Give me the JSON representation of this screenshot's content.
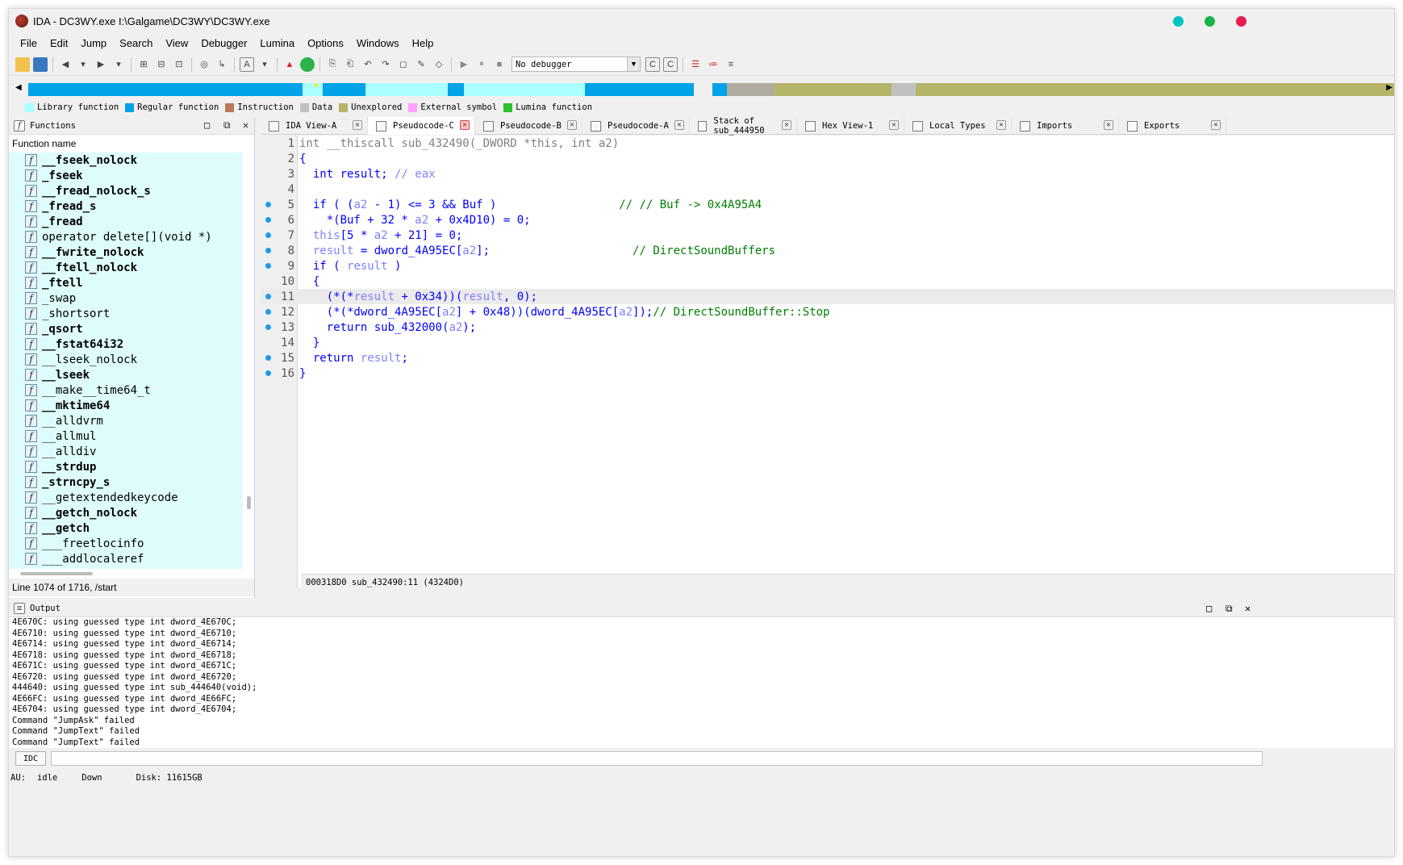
{
  "window": {
    "title": "IDA - DC3WY.exe I:\\Galgame\\DC3WY\\DC3WY.exe",
    "controls": {
      "minimize_color": "#00c3c3",
      "maximize_color": "#1ab34a",
      "close_color": "#e81c4f"
    }
  },
  "menu": [
    "File",
    "Edit",
    "Jump",
    "Search",
    "View",
    "Debugger",
    "Lumina",
    "Options",
    "Windows",
    "Help"
  ],
  "toolbar": {
    "debugger_select": "No debugger"
  },
  "legend": [
    {
      "label": "Library function",
      "color": "#aaffff"
    },
    {
      "label": "Regular function",
      "color": "#00a2e8"
    },
    {
      "label": "Instruction",
      "color": "#b9795b"
    },
    {
      "label": "Data",
      "color": "#c0c0c0"
    },
    {
      "label": "Unexplored",
      "color": "#b5b56a"
    },
    {
      "label": "External symbol",
      "color": "#ffa0ff"
    },
    {
      "label": "Lumina function",
      "color": "#2ec02e"
    }
  ],
  "functions": {
    "title": "Functions",
    "column": "Function name",
    "items": [
      {
        "name": "__fseek_nolock",
        "bold": true
      },
      {
        "name": "_fseek",
        "bold": true
      },
      {
        "name": "__fread_nolock_s",
        "bold": true
      },
      {
        "name": "_fread_s",
        "bold": true
      },
      {
        "name": "_fread",
        "bold": true
      },
      {
        "name": "operator delete[](void *)",
        "bold": false
      },
      {
        "name": "__fwrite_nolock",
        "bold": true
      },
      {
        "name": "__ftell_nolock",
        "bold": true
      },
      {
        "name": "_ftell",
        "bold": true
      },
      {
        "name": "_swap",
        "bold": false
      },
      {
        "name": "_shortsort",
        "bold": false
      },
      {
        "name": "_qsort",
        "bold": true
      },
      {
        "name": "__fstat64i32",
        "bold": true
      },
      {
        "name": "__lseek_nolock",
        "bold": false
      },
      {
        "name": "__lseek",
        "bold": true
      },
      {
        "name": "__make__time64_t",
        "bold": false
      },
      {
        "name": "__mktime64",
        "bold": true
      },
      {
        "name": "__alldvrm",
        "bold": false
      },
      {
        "name": "__allmul",
        "bold": false
      },
      {
        "name": "__alldiv",
        "bold": false
      },
      {
        "name": "__strdup",
        "bold": true
      },
      {
        "name": "_strncpy_s",
        "bold": true
      },
      {
        "name": "__getextendedkeycode",
        "bold": false
      },
      {
        "name": "__getch_nolock",
        "bold": true
      },
      {
        "name": "__getch",
        "bold": true
      },
      {
        "name": "___freetlocinfo",
        "bold": false
      },
      {
        "name": "___addlocaleref",
        "bold": false
      }
    ],
    "status": "Line 1074 of 1716, /start"
  },
  "tabs": [
    {
      "label": "IDA View-A",
      "active": false
    },
    {
      "label": "Pseudocode-C",
      "active": true
    },
    {
      "label": "Pseudocode-B",
      "active": false
    },
    {
      "label": "Pseudocode-A",
      "active": false
    },
    {
      "label": "Stack of sub_444950",
      "active": false
    },
    {
      "label": "Hex View-1",
      "active": false
    },
    {
      "label": "Local Types",
      "active": false
    },
    {
      "label": "Imports",
      "active": false
    },
    {
      "label": "Exports",
      "active": false
    }
  ],
  "code": {
    "lines": [
      {
        "n": "1",
        "dot": false,
        "segs": [
          [
            "gr",
            "int __thiscall sub_432490(_DWORD *this, int a2)"
          ]
        ]
      },
      {
        "n": "2",
        "dot": false,
        "segs": [
          [
            "kw",
            "{"
          ]
        ]
      },
      {
        "n": "3",
        "dot": false,
        "segs": [
          [
            "kw",
            "  int result; "
          ],
          [
            "var",
            "// eax"
          ]
        ]
      },
      {
        "n": "4",
        "dot": false,
        "segs": []
      },
      {
        "n": "5",
        "dot": true,
        "segs": [
          [
            "kw",
            "  if ( ("
          ],
          [
            "var",
            "a2"
          ],
          [
            "kw",
            " - 1) <= 3 && Buf )                  "
          ],
          [
            "cm",
            "// // Buf -> 0x4A95A4"
          ]
        ]
      },
      {
        "n": "6",
        "dot": true,
        "segs": [
          [
            "kw",
            "    *(Buf + 32 * "
          ],
          [
            "var",
            "a2"
          ],
          [
            "kw",
            " + 0x4D10) = 0;"
          ]
        ]
      },
      {
        "n": "7",
        "dot": true,
        "segs": [
          [
            "var",
            "  this"
          ],
          [
            "kw",
            "[5 * "
          ],
          [
            "var",
            "a2"
          ],
          [
            "kw",
            " + 21] = 0;"
          ]
        ]
      },
      {
        "n": "8",
        "dot": true,
        "segs": [
          [
            "var",
            "  result"
          ],
          [
            "kw",
            " = dword_4A95EC["
          ],
          [
            "var",
            "a2"
          ],
          [
            "kw",
            "];                     "
          ],
          [
            "cm",
            "// DirectSoundBuffers"
          ]
        ]
      },
      {
        "n": "9",
        "dot": true,
        "segs": [
          [
            "kw",
            "  if ( "
          ],
          [
            "var",
            "result"
          ],
          [
            "kw",
            " )"
          ]
        ]
      },
      {
        "n": "10",
        "dot": false,
        "segs": [
          [
            "kw",
            "  {"
          ]
        ]
      },
      {
        "n": "11",
        "dot": true,
        "segs": [
          [
            "kw",
            "    (*(*"
          ],
          [
            "var",
            "result"
          ],
          [
            "kw",
            " + 0x34))("
          ],
          [
            "var",
            "result"
          ],
          [
            "kw",
            ", 0);"
          ]
        ]
      },
      {
        "n": "12",
        "dot": true,
        "segs": [
          [
            "kw",
            "    (*(*dword_4A95EC["
          ],
          [
            "var",
            "a2"
          ],
          [
            "kw",
            "] + 0x48))(dword_4A95EC["
          ],
          [
            "var",
            "a2"
          ],
          [
            "kw",
            "]);"
          ],
          [
            "cm",
            "// DirectSoundBuffer::Stop"
          ]
        ]
      },
      {
        "n": "13",
        "dot": true,
        "segs": [
          [
            "kw",
            "    return sub_432000("
          ],
          [
            "var",
            "a2"
          ],
          [
            "kw",
            ");"
          ]
        ]
      },
      {
        "n": "14",
        "dot": false,
        "segs": [
          [
            "kw",
            "  }"
          ]
        ]
      },
      {
        "n": "15",
        "dot": true,
        "segs": [
          [
            "kw",
            "  return "
          ],
          [
            "var",
            "result"
          ],
          [
            "kw",
            ";"
          ]
        ]
      },
      {
        "n": "16",
        "dot": true,
        "segs": [
          [
            "kw",
            "}"
          ]
        ]
      }
    ],
    "highlight_line": "11",
    "status": "000318D0 sub_432490:11 (4324D0)"
  },
  "output": {
    "title": "Output",
    "lines": [
      "4E670C: using guessed type int dword_4E670C;",
      "4E6710: using guessed type int dword_4E6710;",
      "4E6714: using guessed type int dword_4E6714;",
      "4E6718: using guessed type int dword_4E6718;",
      "4E671C: using guessed type int dword_4E671C;",
      "4E6720: using guessed type int dword_4E6720;",
      "444640: using guessed type int sub_444640(void);",
      "4E66FC: using guessed type int dword_4E66FC;",
      "4E6704: using guessed type int dword_4E6704;",
      "Command \"JumpAsk\" failed",
      "Command \"JumpText\" failed",
      "Command \"JumpText\" failed"
    ],
    "idc_label": "IDC"
  },
  "statusbar": {
    "au_label": "AU:",
    "au_state": "idle",
    "direction": "Down",
    "disk": "Disk: 11615GB"
  }
}
